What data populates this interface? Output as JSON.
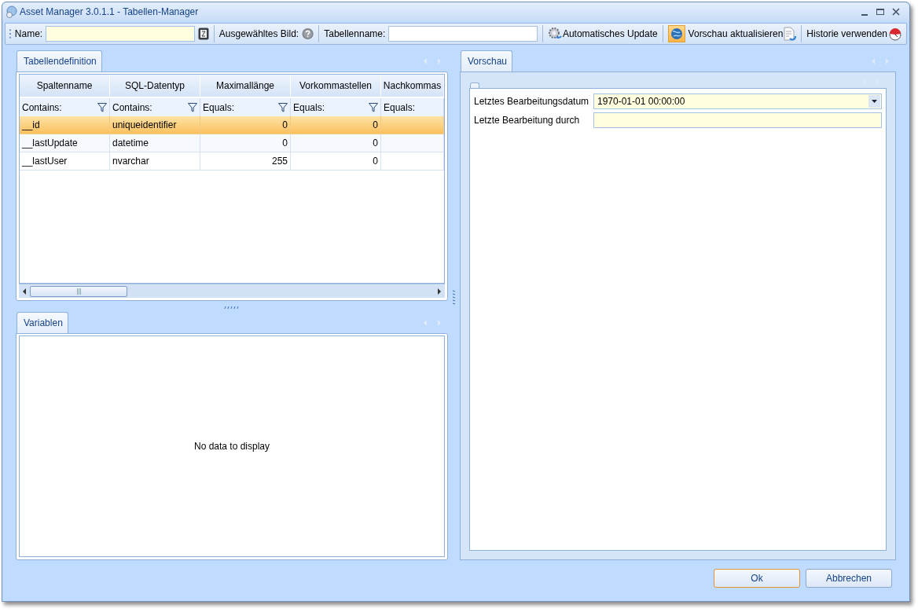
{
  "window": {
    "title": "Asset Manager 3.0.1.1 - Tabellen-Manager"
  },
  "toolbar": {
    "name_label": "Name:",
    "image_label": "Ausgewähltes Bild:",
    "table_name_label": "Tabellenname:",
    "buttons": [
      {
        "kind": "auto",
        "label": "Automatisches Update"
      },
      {
        "kind": "preview",
        "label": "Vorschau aktualisieren",
        "on": true
      },
      {
        "kind": "history",
        "label": "Historie verwenden"
      }
    ]
  },
  "definition": {
    "tab": "Tabellendefinition",
    "columns": [
      {
        "title": "Spaltenname",
        "filter": "Contains:",
        "filter_button": true
      },
      {
        "title": "SQL-Datentyp",
        "filter": "Contains:",
        "filter_button": true
      },
      {
        "title": "Maximallänge",
        "filter": "Equals:",
        "filter_button": true
      },
      {
        "title": "Vorkommastellen",
        "filter": "Equals:",
        "filter_button": true
      },
      {
        "title": "Nachkommas",
        "filter": "Equals:",
        "filter_button": false
      }
    ],
    "rows": [
      {
        "selected": true,
        "cells": [
          "__id",
          "uniqueidentifier",
          "0",
          "0"
        ]
      },
      {
        "selected": false,
        "cells": [
          "__lastUpdate",
          "datetime",
          "0",
          "0"
        ]
      },
      {
        "selected": false,
        "cells": [
          "__lastUser",
          "nvarchar",
          "255",
          "0"
        ]
      }
    ]
  },
  "variables": {
    "tab": "Variablen",
    "empty_text": "No data to display"
  },
  "preview": {
    "tab": "Vorschau",
    "fields": [
      {
        "kind": "combo",
        "label": "Letztes Bearbeitungsdatum",
        "value": "1970-01-01 00:00:00"
      },
      {
        "kind": "text",
        "label": "Letzte Bearbeitung durch"
      }
    ]
  },
  "buttons": [
    {
      "label": "Ok",
      "default": true
    },
    {
      "label": "Abbrechen",
      "default": false
    }
  ]
}
